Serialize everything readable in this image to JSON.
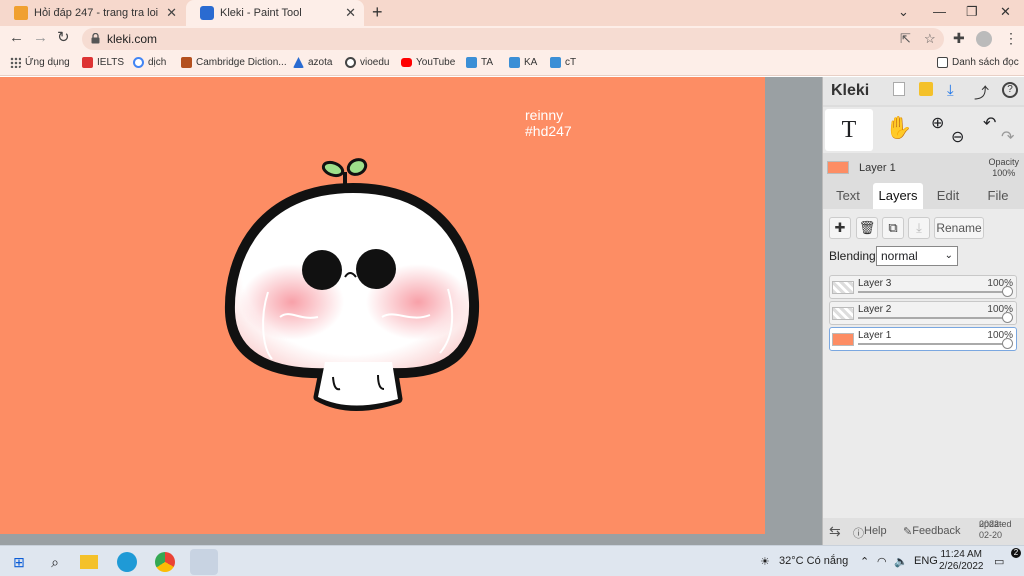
{
  "browser": {
    "tabs": [
      {
        "title": "Hỏi đáp 247 - trang tra loi"
      },
      {
        "title": "Kleki - Paint Tool"
      }
    ],
    "url": "kleki.com",
    "bookmarks": [
      {
        "label": "Ứng dụng",
        "icon": "apps-grid-icon"
      },
      {
        "label": "IELTS",
        "icon": "ielts-icon"
      },
      {
        "label": "dịch",
        "icon": "google-icon"
      },
      {
        "label": "Cambridge Diction...",
        "icon": "cambridge-icon"
      },
      {
        "label": "azota",
        "icon": "azota-icon"
      },
      {
        "label": "vioedu",
        "icon": "vioedu-icon"
      },
      {
        "label": "YouTube",
        "icon": "youtube-icon"
      },
      {
        "label": "TA",
        "icon": "folder-icon"
      },
      {
        "label": "KA",
        "icon": "folder-icon"
      },
      {
        "label": "cT",
        "icon": "folder-icon"
      }
    ],
    "reading_list": "Danh sách đọc"
  },
  "canvas": {
    "signature_line1": "reinny",
    "signature_line2": "#hd247",
    "background_color": "#fd8d64"
  },
  "kleki": {
    "logo": "Kleki",
    "active_layer": {
      "name": "Layer 1",
      "opacity_label": "Opacity",
      "opacity_value": "100%"
    },
    "tabs": [
      "Text",
      "Layers",
      "Edit",
      "File"
    ],
    "active_tab": "Layers",
    "rename_label": "Rename",
    "blending_label": "Blending",
    "blending_value": "normal",
    "layers": [
      {
        "name": "Layer 3",
        "opacity": "100%"
      },
      {
        "name": "Layer 2",
        "opacity": "100%"
      },
      {
        "name": "Layer 1",
        "opacity": "100%"
      }
    ],
    "footer": {
      "help": "Help",
      "feedback": "Feedback",
      "updated_label": "updated",
      "updated_date": "2022-02-20"
    }
  },
  "taskbar": {
    "weather": "32°C  Có nắng",
    "language": "ENG",
    "time": "11:24 AM",
    "date": "2/26/2022",
    "notification_count": "2"
  }
}
